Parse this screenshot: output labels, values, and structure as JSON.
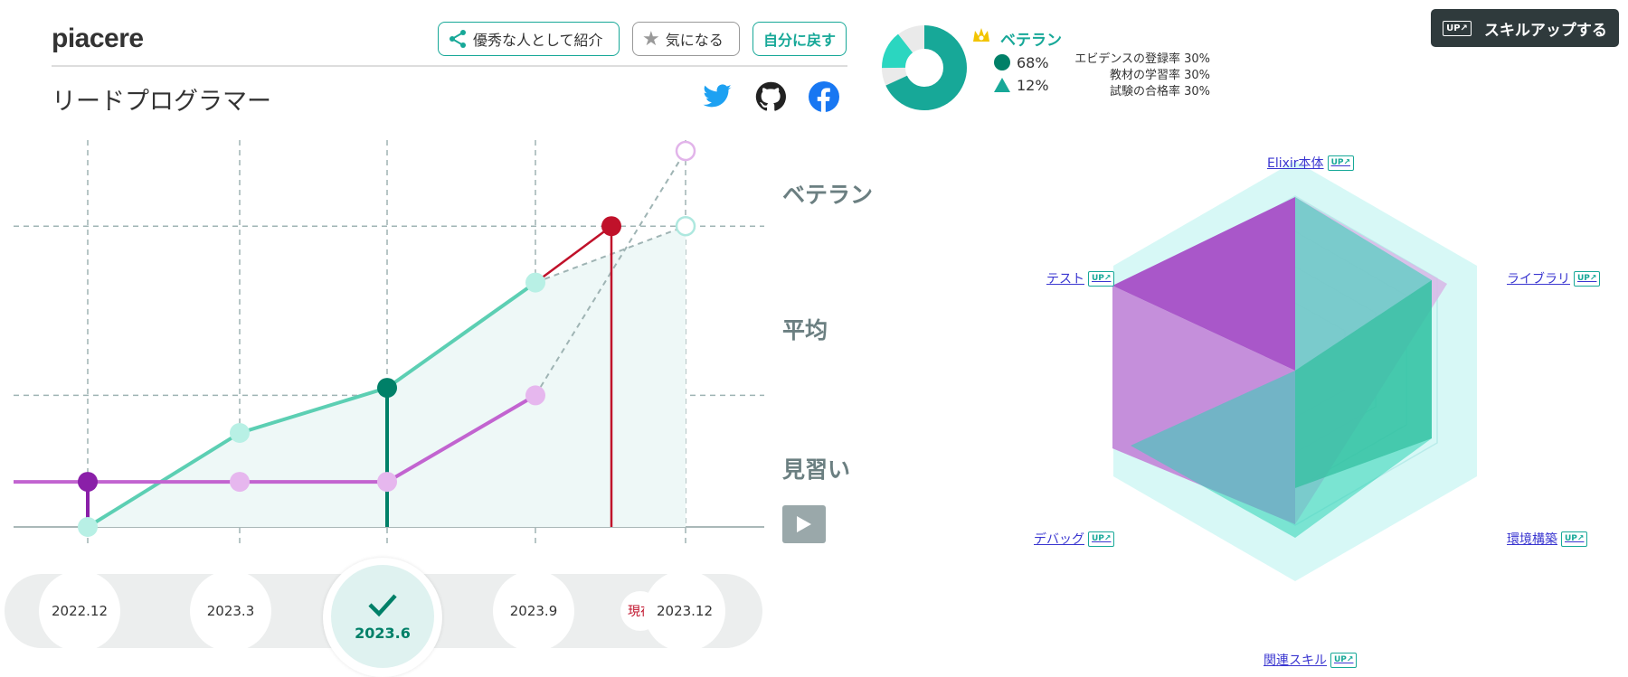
{
  "header": {
    "brand": "piacere",
    "role": "リードプログラマー",
    "recommend_label": "優秀な人として紹介",
    "interest_label": "気になる",
    "back_label": "自分に戻す",
    "social_icons": [
      "twitter-icon",
      "github-icon",
      "facebook-icon"
    ]
  },
  "rank": {
    "title": "ベテラン",
    "circle_pct": "68%",
    "triangle_pct": "12%",
    "evidence": [
      "エビデンスの登録率 30%",
      "教材の学習率 30%",
      "試験の合格率 30%"
    ],
    "donut_fill": 0.68
  },
  "skillup_label": "スキルアップする",
  "levels": [
    "ベテラン",
    "平均",
    "見習い"
  ],
  "timeline": {
    "items": [
      "2022.12",
      "2023.3",
      "2023.6",
      "2023.9",
      "2023.12"
    ],
    "selected": "2023.6",
    "now_label": "現在"
  },
  "radar_labels": [
    "Elixir本体",
    "ライブラリ",
    "環境構築",
    "関連スキル",
    "デバッグ",
    "テスト"
  ],
  "up_tag": "UP↗",
  "chart_data": {
    "type": "line",
    "categories": [
      "2022.12",
      "2023.3",
      "2023.6",
      "2023.9",
      "2023.12"
    ],
    "series": [
      {
        "values": [
          0,
          0.25,
          0.37,
          0.65,
          0.8
        ],
        "color": "#5ccfb3"
      },
      {
        "values": [
          0.12,
          0.12,
          0.12,
          0.35,
          1.0
        ],
        "color": "#c264d0"
      }
    ],
    "ylim": [
      0,
      1
    ],
    "colors": {
      "teal": "#5ccfb3",
      "purple": "#c264d0",
      "red": "#c0112a",
      "dark_teal": "#008068"
    }
  }
}
